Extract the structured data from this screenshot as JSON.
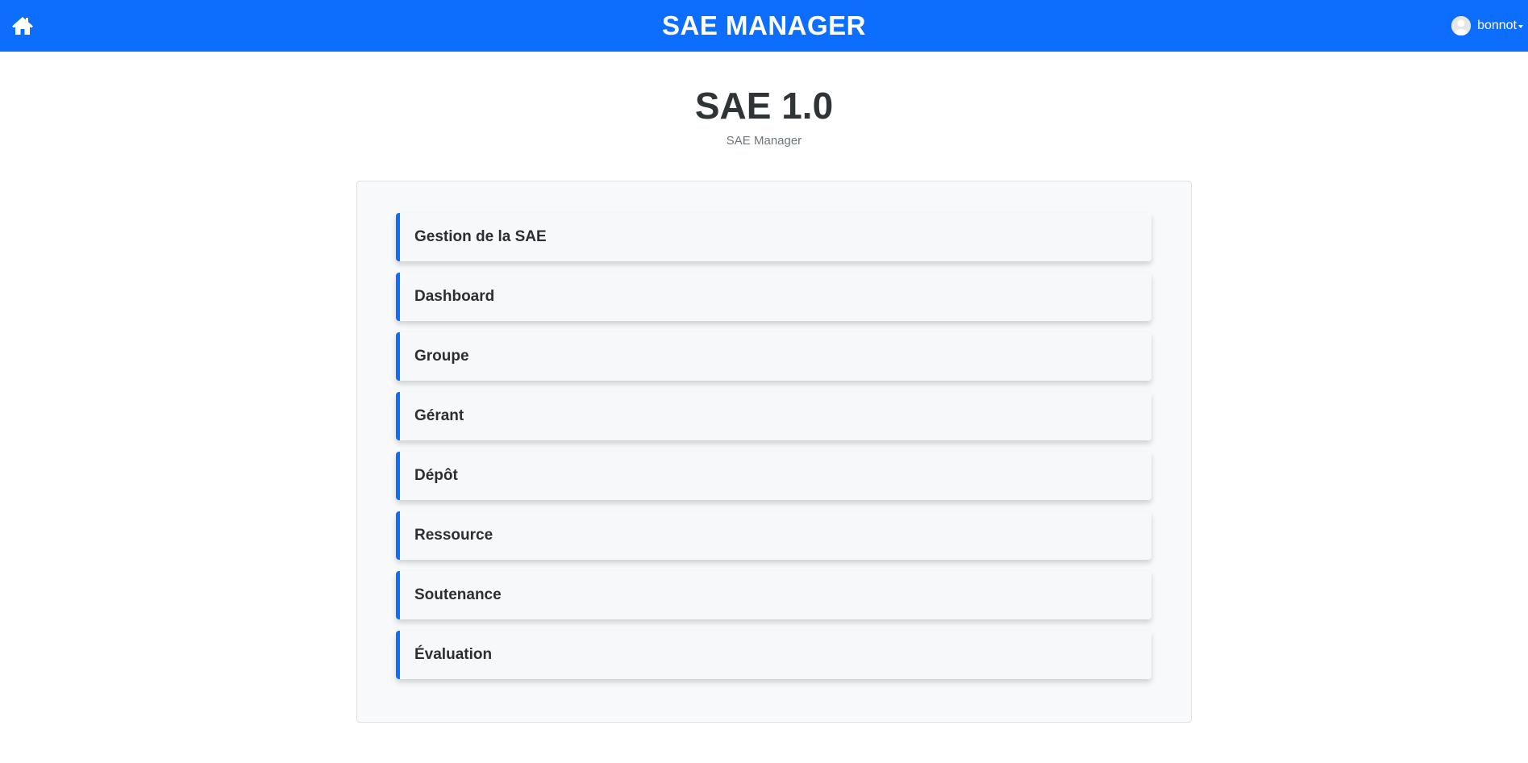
{
  "header": {
    "brand": "SAE MANAGER",
    "home_icon": "home-icon",
    "user": {
      "name": "bonnot",
      "avatar_icon": "user-avatar-icon"
    },
    "background_color": "#0d6efd"
  },
  "main": {
    "title": "SAE 1.0",
    "subtitle": "SAE Manager",
    "menu_items": [
      {
        "label": "Gestion de la SAE"
      },
      {
        "label": "Dashboard"
      },
      {
        "label": "Groupe"
      },
      {
        "label": "Gérant"
      },
      {
        "label": "Dépôt"
      },
      {
        "label": "Ressource"
      },
      {
        "label": "Soutenance"
      },
      {
        "label": "Évaluation"
      }
    ],
    "accent_color": "#0d6efd"
  }
}
